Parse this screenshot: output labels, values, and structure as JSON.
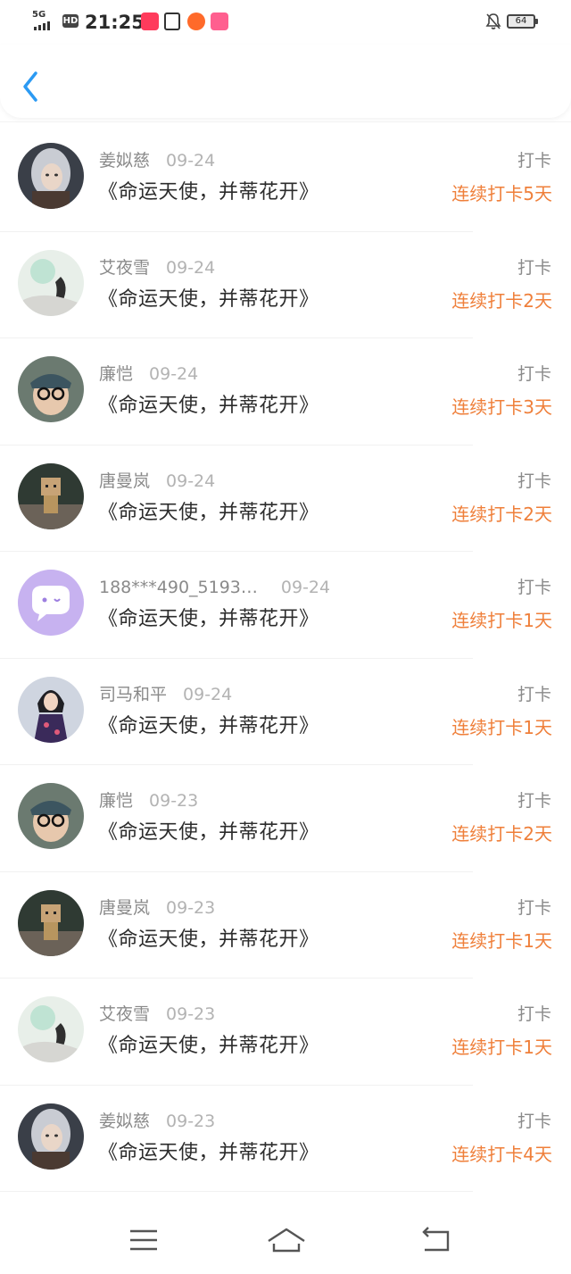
{
  "status_bar": {
    "network": "5G",
    "hd": "HD",
    "time": "21:25",
    "battery": "64"
  },
  "header": {
    "back_icon": "chevron-left-icon",
    "accent_color": "#2b9af3"
  },
  "colors": {
    "streak": "#ef7f3a",
    "name": "#8a8a8a",
    "date": "#b3b3b3"
  },
  "records": [
    {
      "name": "姜姒慈",
      "date": "09-24",
      "book": "《命运天使，并蒂花开》",
      "action": "打卡",
      "streak": "连续打卡5天",
      "avatar": "avatar-girl-silver-hair"
    },
    {
      "name": "艾夜雪",
      "date": "09-24",
      "book": "《命运天使，并蒂花开》",
      "action": "打卡",
      "streak": "连续打卡2天",
      "avatar": "avatar-ink-painting"
    },
    {
      "name": "廉恺",
      "date": "09-24",
      "book": "《命运天使，并蒂花开》",
      "action": "打卡",
      "streak": "连续打卡3天",
      "avatar": "avatar-boy-glasses"
    },
    {
      "name": "唐曼岚",
      "date": "09-24",
      "book": "《命运天使，并蒂花开》",
      "action": "打卡",
      "streak": "连续打卡2天",
      "avatar": "avatar-danbo"
    },
    {
      "name": "188***490_5193…",
      "date": "09-24",
      "book": "《命运天使，并蒂花开》",
      "action": "打卡",
      "streak": "连续打卡1天",
      "avatar": "avatar-default-chat"
    },
    {
      "name": "司马和平",
      "date": "09-24",
      "book": "《命运天使，并蒂花开》",
      "action": "打卡",
      "streak": "连续打卡1天",
      "avatar": "avatar-woman-dress"
    },
    {
      "name": "廉恺",
      "date": "09-23",
      "book": "《命运天使，并蒂花开》",
      "action": "打卡",
      "streak": "连续打卡2天",
      "avatar": "avatar-boy-glasses"
    },
    {
      "name": "唐曼岚",
      "date": "09-23",
      "book": "《命运天使，并蒂花开》",
      "action": "打卡",
      "streak": "连续打卡1天",
      "avatar": "avatar-danbo"
    },
    {
      "name": "艾夜雪",
      "date": "09-23",
      "book": "《命运天使，并蒂花开》",
      "action": "打卡",
      "streak": "连续打卡1天",
      "avatar": "avatar-ink-painting"
    },
    {
      "name": "姜姒慈",
      "date": "09-23",
      "book": "《命运天使，并蒂花开》",
      "action": "打卡",
      "streak": "连续打卡4天",
      "avatar": "avatar-girl-silver-hair"
    }
  ],
  "bottom_nav": {
    "menu_icon": "menu-icon",
    "home_icon": "home-icon",
    "back_icon": "back-icon"
  }
}
